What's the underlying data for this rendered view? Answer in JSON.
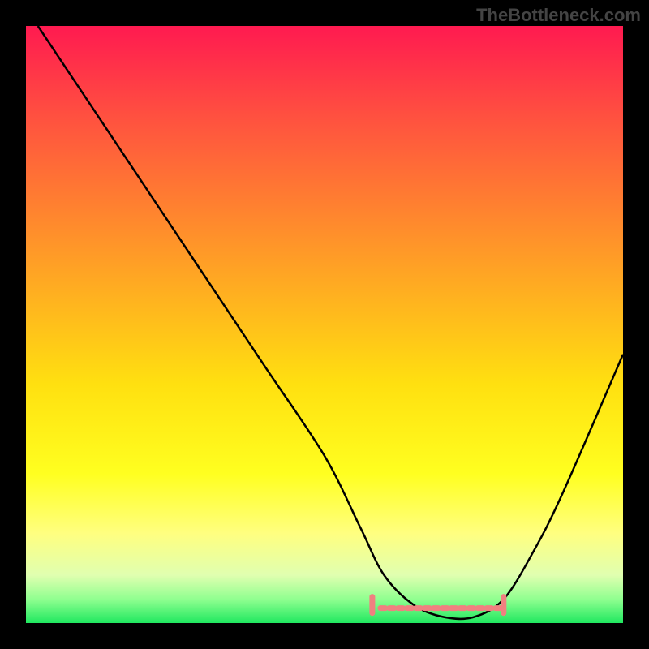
{
  "watermark": "TheBottleneck.com",
  "chart_data": {
    "type": "line",
    "title": "",
    "xlabel": "",
    "ylabel": "",
    "xlim": [
      0,
      100
    ],
    "ylim": [
      0,
      100
    ],
    "grid": false,
    "series": [
      {
        "name": "curve",
        "x": [
          2,
          10,
          20,
          30,
          40,
          50,
          56,
          60,
          65,
          70,
          75,
          80,
          85,
          90,
          100
        ],
        "y": [
          100,
          88,
          73,
          58,
          43,
          28,
          16,
          8,
          3,
          1,
          1,
          4,
          12,
          22,
          45
        ],
        "color": "#000000"
      }
    ],
    "highlight_band": {
      "name": "optimal-range",
      "x": [
        58,
        80
      ],
      "y_approx": 2.5,
      "color": "#f08080"
    },
    "gradient_stops": [
      {
        "pos": 0.0,
        "color": "#ff1a50"
      },
      {
        "pos": 0.15,
        "color": "#ff5040"
      },
      {
        "pos": 0.3,
        "color": "#ff8030"
      },
      {
        "pos": 0.45,
        "color": "#ffb020"
      },
      {
        "pos": 0.6,
        "color": "#ffe010"
      },
      {
        "pos": 0.75,
        "color": "#ffff20"
      },
      {
        "pos": 0.85,
        "color": "#ffff80"
      },
      {
        "pos": 0.92,
        "color": "#e0ffb0"
      },
      {
        "pos": 0.96,
        "color": "#90ff90"
      },
      {
        "pos": 1.0,
        "color": "#20e860"
      }
    ]
  }
}
